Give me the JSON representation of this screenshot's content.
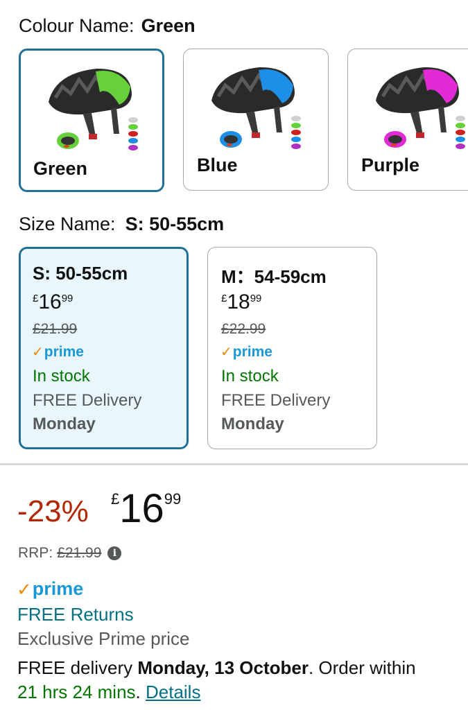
{
  "colour": {
    "label": "Colour Name:",
    "selected": "Green",
    "options": [
      {
        "label": "Green",
        "accent": "#66d13a",
        "selected": true
      },
      {
        "label": "Blue",
        "accent": "#1e8fe6",
        "selected": false
      },
      {
        "label": "Purple",
        "accent": "#e22bd6",
        "selected": false
      }
    ]
  },
  "size": {
    "label": "Size Name:",
    "selected": "S: 50-55cm",
    "options": [
      {
        "name": "S: 50-55cm",
        "currency": "£",
        "whole": "16",
        "fraction": "99",
        "was": "£21.99",
        "prime": "prime",
        "stock": "In stock",
        "delivery": "FREE Delivery",
        "day": "Monday",
        "selected": true
      },
      {
        "name": "M：54-59cm",
        "currency": "£",
        "whole": "18",
        "fraction": "99",
        "was": "£22.99",
        "prime": "prime",
        "stock": "In stock",
        "delivery": "FREE Delivery",
        "day": "Monday",
        "selected": false
      }
    ]
  },
  "pricing": {
    "discount": "-23%",
    "currency": "£",
    "whole": "16",
    "fraction": "99",
    "rrp_label": "RRP:",
    "rrp_value": "£21.99"
  },
  "prime": {
    "logo": "prime",
    "free_returns": "FREE Returns",
    "exclusive": "Exclusive Prime price"
  },
  "delivery": {
    "prefix": "FREE delivery ",
    "date": "Monday, 13 October",
    "suffix": ". Order within",
    "countdown": "21 hrs 24 mins",
    "sep": ". ",
    "details_link": "Details"
  },
  "icons": {
    "info": "info-icon",
    "prime_check": "prime-check-icon"
  },
  "colors": {
    "selected_border": "#1f6f99",
    "selected_bg": "#e9f6fb",
    "price_red": "#b12704",
    "stock_green": "#007600",
    "link_teal": "#007185",
    "prime_blue": "#1a98d5",
    "prime_orange": "#f08804"
  }
}
